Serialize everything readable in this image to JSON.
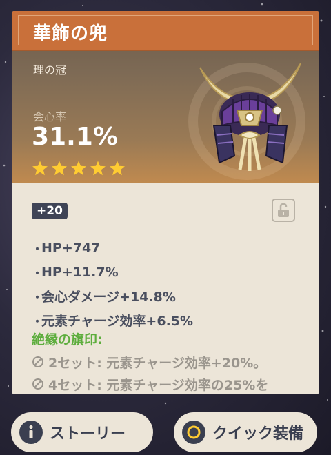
{
  "artifact": {
    "name": "華飾の兜",
    "slot": "理の冠",
    "main_stat_label": "会心率",
    "main_stat_value": "31.1%",
    "rarity_stars": 5,
    "level": "+20",
    "locked": false
  },
  "sub_stats": [
    {
      "bullet": "・",
      "text": "HP+747"
    },
    {
      "bullet": "・",
      "text": "HP+11.7%"
    },
    {
      "bullet": "・",
      "text": "会心ダメージ+14.8%"
    },
    {
      "bullet": "・",
      "text": "元素チャージ効率+6.5%"
    }
  ],
  "set": {
    "name": "絶縁の旗印:",
    "bonus_2": "2セット: 元素チャージ効率+20%。",
    "bonus_4": "4セット: 元素チャージ効率の25%を"
  },
  "buttons": {
    "story": "ストーリー",
    "quick_equip": "クイック装備"
  },
  "colors": {
    "title_bar": "#c9703a",
    "set_name": "#5dad3d",
    "star": "#ffcc32",
    "card_bg": "#ece5d8"
  },
  "icons": [
    "star-icon",
    "lock-open-icon",
    "info-icon",
    "circle-button-icon",
    "disabled-slash-icon"
  ]
}
